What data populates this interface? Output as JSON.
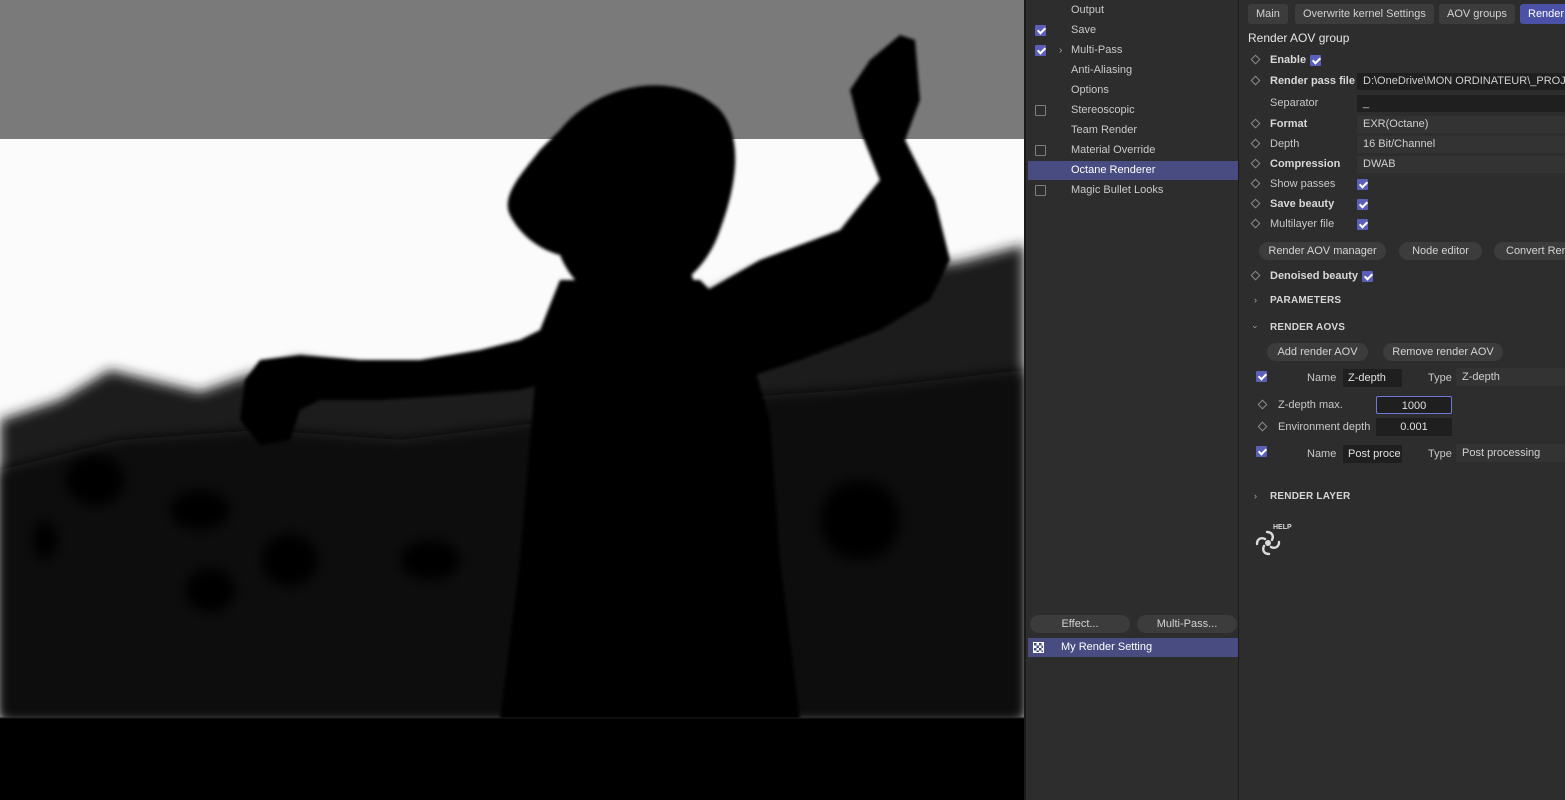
{
  "settings_list": {
    "items": [
      {
        "label": "Output",
        "checkbox": "none"
      },
      {
        "label": "Save",
        "checkbox": "checked"
      },
      {
        "label": "Multi-Pass",
        "checkbox": "checked",
        "expandable": true
      },
      {
        "label": "Anti-Aliasing",
        "checkbox": "none"
      },
      {
        "label": "Options",
        "checkbox": "none"
      },
      {
        "label": "Stereoscopic",
        "checkbox": "unchecked"
      },
      {
        "label": "Team Render",
        "checkbox": "none"
      },
      {
        "label": "Material Override",
        "checkbox": "unchecked"
      },
      {
        "label": "Octane Renderer",
        "checkbox": "none",
        "selected": true
      },
      {
        "label": "Magic Bullet Looks",
        "checkbox": "unchecked"
      }
    ],
    "effect_button": "Effect...",
    "multipass_button": "Multi-Pass...",
    "render_setting": "My Render Setting"
  },
  "tabs": [
    "Main",
    "Overwrite kernel Settings",
    "AOV groups",
    "Render"
  ],
  "active_tab": "Render",
  "group_title": "Render AOV group",
  "fields": {
    "enable": "Enable",
    "render_pass_file_label": "Render pass file",
    "render_pass_file_value": "D:\\OneDrive\\MON ORDINATEUR\\_PROJET",
    "separator_label": "Separator",
    "separator_value": "_",
    "format_label": "Format",
    "format_value": "EXR(Octane)",
    "depth_label": "Depth",
    "depth_value": "16 Bit/Channel",
    "compression_label": "Compression",
    "compression_value": "DWAB",
    "show_passes": "Show passes",
    "save_beauty": "Save beauty",
    "multilayer_file": "Multilayer file"
  },
  "buttons": {
    "aov_manager": "Render AOV manager",
    "node_editor": "Node editor",
    "convert": "Convert Ren",
    "add_aov": "Add render AOV",
    "remove_aov": "Remove render AOV"
  },
  "denoised_beauty": "Denoised beauty",
  "sections": {
    "parameters": "PARAMETERS",
    "render_aovs": "RENDER AOVS",
    "render_layer": "RENDER LAYER"
  },
  "aovs": {
    "name_label": "Name",
    "type_label": "Type",
    "aov1_name": "Z-depth",
    "aov1_type": "Z-depth",
    "zdepth_max_label": "Z-depth max.",
    "zdepth_max_value": "1000",
    "env_depth_label": "Environment depth",
    "env_depth_value": "0.001",
    "aov2_name": "Post proce",
    "aov2_type": "Post processing"
  },
  "help_label": "HELP",
  "colors": {
    "accent": "#4b51a6",
    "selected_row": "#484c80",
    "panel_bg": "#2d2d2d",
    "warning_label": "#e89a3c"
  }
}
